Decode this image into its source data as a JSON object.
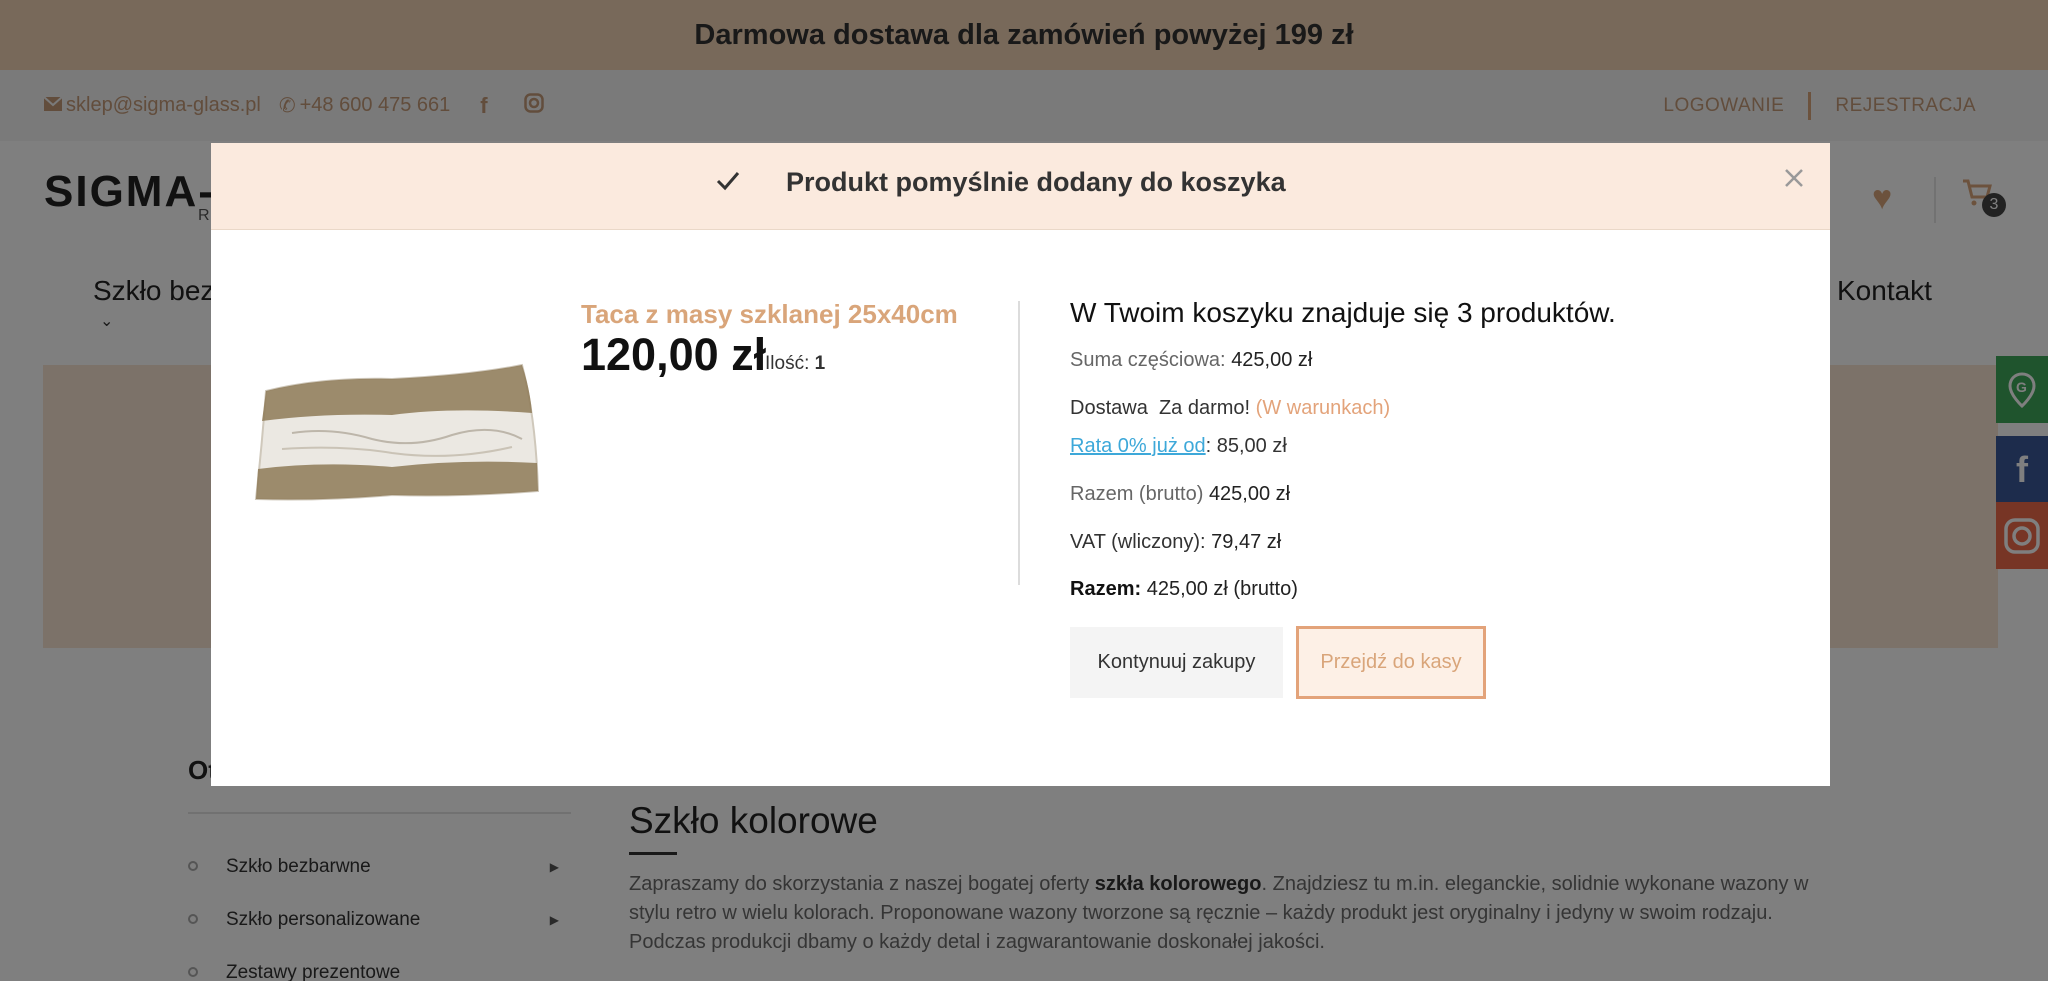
{
  "promo_bar": {
    "text": "Darmowa dostawa dla zamówień powyżej 199 zł"
  },
  "contact": {
    "email": "sklep@sigma-glass.pl",
    "phone": "+48 600 475 661"
  },
  "auth": {
    "login": "LOGOWANIE",
    "register": "REJESTRACJA"
  },
  "logo": {
    "text": "SIGMA-G",
    "sub": "R"
  },
  "cart": {
    "count": "3"
  },
  "nav": {
    "first_item": "Szkło bez",
    "last_item": "Kontakt"
  },
  "sidebar": {
    "title": "Ot",
    "items": [
      {
        "label": "Szkło bezbarwne"
      },
      {
        "label": "Szkło personalizowane"
      },
      {
        "label": "Zestawy prezentowe"
      }
    ]
  },
  "content": {
    "title": "Szkło kolorowe",
    "text_before": "Zapraszamy do skorzystania z naszej bogatej oferty ",
    "text_bold": "szkła kolorowego",
    "text_after": ". Znajdziesz tu m.in. eleganckie, solidnie wykonane wazony w stylu retro w wielu kolorach. Proponowane wazony tworzone są ręcznie – każdy produkt jest oryginalny i jedyny w swoim rodzaju. Podczas produkcji dbamy o każdy detal i zagwarantowanie doskonałej jakości."
  },
  "modal": {
    "title": "Produkt pomyślnie dodany do koszyka",
    "product": {
      "name": "Taca z masy szklanej 25x40cm",
      "price": "120,00 zł",
      "qty_label": "Ilość:",
      "qty_value": "1"
    },
    "summary": {
      "heading": "W Twoim koszyku znajduje się 3 produktów.",
      "subtotal_label": "Suma częściowa:",
      "subtotal_value": "425,00 zł",
      "shipping_label": "Dostawa",
      "shipping_value": "Za darmo!",
      "shipping_note": "(W warunkach)",
      "installment_link": "Rata 0% już od",
      "installment_value": ": 85,00 zł",
      "gross_label": "Razem (brutto)",
      "gross_value": "425,00 zł",
      "vat_label": "VAT (wliczony):",
      "vat_value": "79,47 zł",
      "total_label": "Razem:",
      "total_value": "425,00 zł (brutto)"
    },
    "buttons": {
      "continue": "Kontynuuj zakupy",
      "checkout": "Przejdź do kasy"
    }
  },
  "colors": {
    "accent": "#d9a57a",
    "promo_bg": "#f0d2b4",
    "link": "#3da8d9"
  },
  "icons": [
    "mail-icon",
    "phone-icon",
    "facebook-icon",
    "instagram-icon",
    "heart-icon",
    "cart-icon",
    "check-icon",
    "close-icon",
    "chevron-down-icon",
    "google-maps-icon"
  ]
}
